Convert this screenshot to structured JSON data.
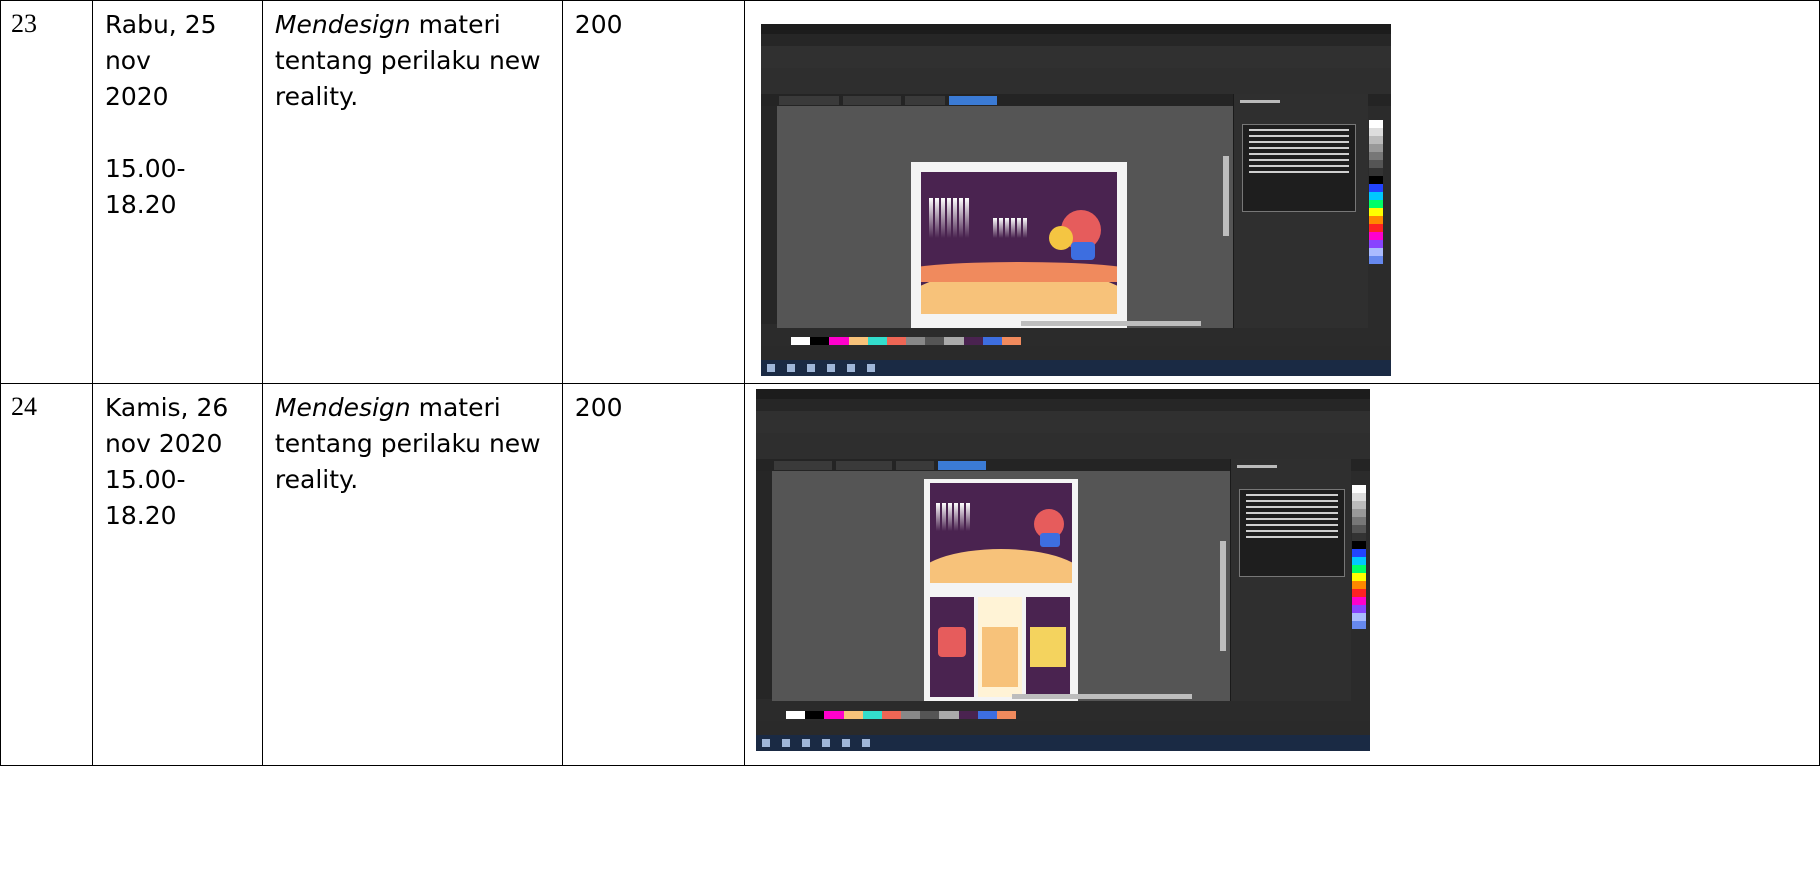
{
  "rows": [
    {
      "number": "23",
      "date_lines": [
        "Rabu, 25 nov",
        "2020",
        "",
        "15.00-18.20"
      ],
      "description_italic": "Mendesign",
      "description_rest": " materi tentang perilaku new reality.",
      "value": "200",
      "screenshot_icon": "coreldraw-screenshot-image"
    },
    {
      "number": "24",
      "date_lines": [
        "Kamis, 26",
        "nov 2020",
        "15.00-18.20"
      ],
      "description_italic": "Mendesign",
      "description_rest": " materi tentang perilaku new reality.",
      "value": "200",
      "screenshot_icon": "coreldraw-screenshot-image"
    }
  ],
  "colors": {
    "app_dark": "#2b2b2b",
    "canvas_gray": "#555555",
    "design_purple": "#4a2350",
    "wave_peach": "#f7c27a",
    "wave_coral": "#f08a5d",
    "active_tab_blue": "#3b7bd5",
    "taskbar_navy": "#1a2a44"
  }
}
